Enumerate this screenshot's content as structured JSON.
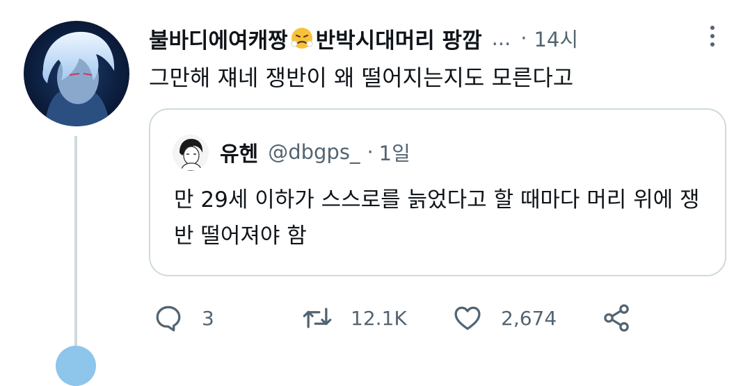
{
  "tweet": {
    "display_name": "불바디에여캐짱",
    "display_name_emoji": "face-with-steam-emoji",
    "display_name_suffix": "반박시대머리 팡깜",
    "truncation": "...",
    "separator": "·",
    "time": "14시",
    "text": "그만해 쟤네 쟁반이 왜 떨어지는지도 모른다고"
  },
  "quote": {
    "display_name": "유헨",
    "handle": "@dbgps_",
    "separator": "·",
    "time": "1일",
    "text": "만 29세 이하가 스스로를 늙었다고 할 때마다 머리 위에 쟁반 떨어져야 함"
  },
  "actions": {
    "reply_count": "3",
    "retweet_count": "12.1K",
    "like_count": "2,674"
  },
  "colors": {
    "text_primary": "#0f1419",
    "text_secondary": "#536471",
    "border": "#cfd9de",
    "thread_line": "#cfd9de"
  },
  "icons": {
    "more": "more-vertical-icon",
    "reply": "reply-icon",
    "retweet": "retweet-icon",
    "like": "heart-icon",
    "share": "share-icon"
  }
}
